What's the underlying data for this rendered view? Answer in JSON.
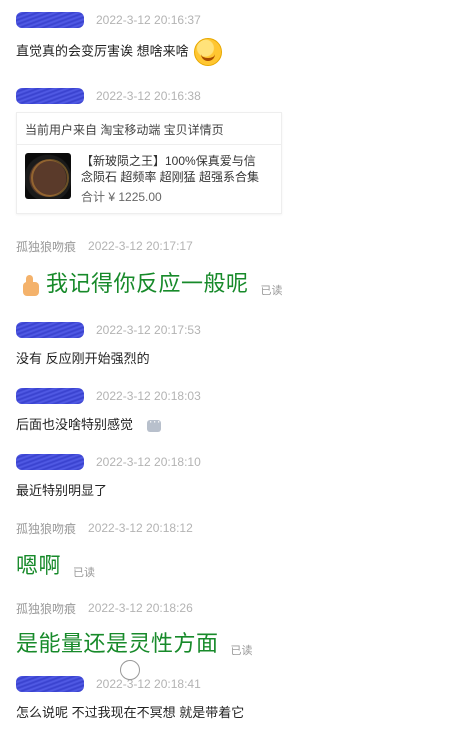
{
  "messages": [
    {
      "sender": "",
      "sender_redacted": true,
      "time": "2022-3-12 20:16:37",
      "text": "直觉真的会变厉害诶 想啥来啥",
      "emoji": "laugh-emoji-icon"
    },
    {
      "sender": "",
      "sender_redacted": true,
      "time": "2022-3-12 20:16:38",
      "card": {
        "header": "当前用户来自 淘宝移动端 宝贝详情页",
        "title_line1": "【新玻陨之王】100%保真爱与信",
        "title_line2": "念陨石 超频率 超刚猛 超强系合集",
        "price": "合计 ¥ 1225.00"
      }
    },
    {
      "sender": "孤独狼吻痕",
      "sender_redacted": false,
      "time": "2022-3-12 20:17:17",
      "text": "我记得你反应一般呢",
      "status": "已读",
      "big": true,
      "emoji": "thumbs-up-emoji-icon"
    },
    {
      "sender": "",
      "sender_redacted": true,
      "time": "2022-3-12 20:17:53",
      "text": "没有 反应刚开始强烈的"
    },
    {
      "sender": "",
      "sender_redacted": true,
      "time": "2022-3-12 20:18:03",
      "text": "后面也没啥特别感觉",
      "typing_icon": "typing-icon"
    },
    {
      "sender": "",
      "sender_redacted": true,
      "time": "2022-3-12 20:18:10",
      "text": "最近特别明显了"
    },
    {
      "sender": "孤独狼吻痕",
      "sender_redacted": false,
      "time": "2022-3-12 20:18:12",
      "text": "嗯啊",
      "status": "已读",
      "big": true
    },
    {
      "sender": "孤独狼吻痕",
      "sender_redacted": false,
      "time": "2022-3-12 20:18:26",
      "text": "是能量还是灵性方面",
      "status": "已读",
      "big": true
    },
    {
      "sender": "",
      "sender_redacted": true,
      "time": "2022-3-12 20:18:41",
      "text": "怎么说呢 不过我现在不冥想 就是带着它"
    }
  ],
  "colors": {
    "accent_green": "#178a2a",
    "timestamp_gray": "#b3b3b3",
    "read_gray": "#9a9a9a",
    "redaction_blue": "#2c35c9"
  }
}
